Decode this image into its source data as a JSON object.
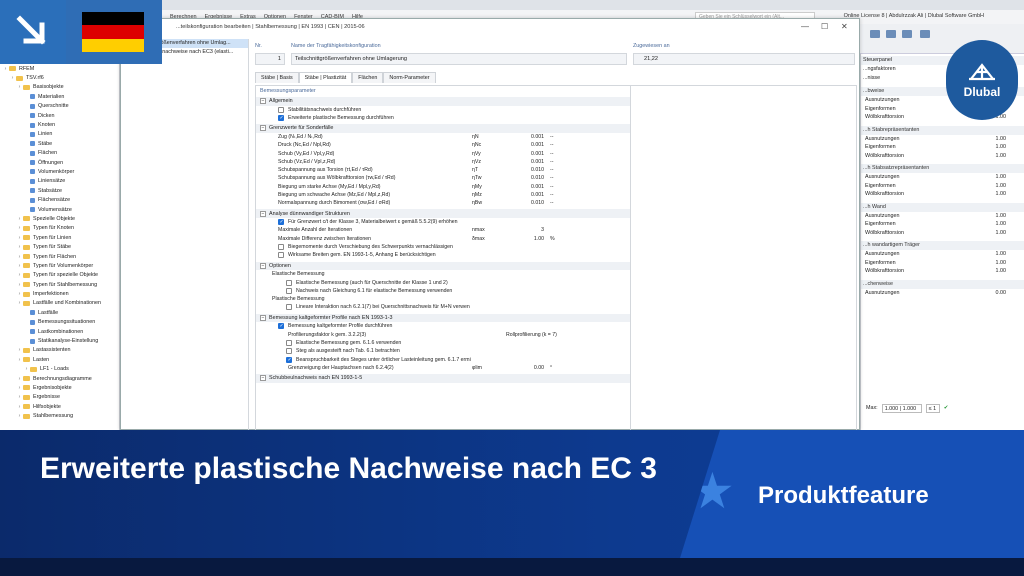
{
  "menubar": {
    "items": [
      "Berechnen",
      "Ergebnisse",
      "Extras",
      "Optionen",
      "Fenster",
      "CAD-BIM",
      "Hilfe"
    ],
    "search_placeholder": "Geben Sie ein Schlüsselwort ein (Alt...",
    "license": "Online License 8 | Abdulrzzak Ali | Dlubal Software GmbH"
  },
  "dialog": {
    "title": "...teilskonfiguration bearbeiten | Stahlbemessung | EN 1993 | CEN | 2015-06",
    "list": [
      {
        "no": "1",
        "name": "Teilschnittgrößenverfahren ohne Umlag...",
        "selected": true
      },
      {
        "no": "2",
        "name": "Querschnittsnachweise nach EC3 (elasti...",
        "selected": false
      }
    ],
    "no_label": "Nr.",
    "no_value": "1",
    "name_label": "Name der Tragfähigkeitskonfiguration",
    "name_value": "Teilschnittgrößenverfahren ohne Umlagerung",
    "assigned_label": "Zugewiesen an",
    "assigned_value": "21,22",
    "tabs": [
      "Stäbe | Basis",
      "Stäbe | Plastizität",
      "Flächen",
      "Norm-Parameter"
    ],
    "active_tab": 1,
    "params_title": "Bemessungsparameter"
  },
  "sections": {
    "allgemein": "Allgemein",
    "grenzwerte": "Grenzwerte für Sonderfälle",
    "analyse": "Analyse dünnwandiger Strukturen",
    "optionen": "Optionen",
    "elastische": "Elastische Bemessung",
    "plastische": "Plastische Bemessung",
    "kaltgeformt": "Bemessung kaltgeformter Profile nach EN 1993-1-3",
    "schubbeul": "Schubbeulnachweis nach EN 1993-1-5"
  },
  "rows": {
    "allg1": "Stabilitätsnachweis durchführen",
    "allg2": "Erweiterte plastische Bemessung durchführen",
    "g": [
      {
        "lab": "Zug (Nₜ,Ed / Nₜ,Rd)",
        "sym": "ηN",
        "val": "0.001",
        "unit": "--"
      },
      {
        "lab": "Druck (Nc,Ed / Npl,Rd)",
        "sym": "ηNc",
        "val": "0.001",
        "unit": "--"
      },
      {
        "lab": "Schub (Vy,Ed / Vpl,y,Rd)",
        "sym": "ηVy",
        "val": "0.001",
        "unit": "--"
      },
      {
        "lab": "Schub (Vz,Ed / Vpl,z,Rd)",
        "sym": "ηVz",
        "val": "0.001",
        "unit": "--"
      },
      {
        "lab": "Schubspannung aus Torsion (τt,Ed / τRd)",
        "sym": "ηT",
        "val": "0.010",
        "unit": "--"
      },
      {
        "lab": "Schubspannung aus Wölbkrafttorsion (τw,Ed / τRd)",
        "sym": "ηTw",
        "val": "0.010",
        "unit": "--"
      },
      {
        "lab": "Biegung um starke Achse (My,Ed / Mpl,y,Rd)",
        "sym": "ηMy",
        "val": "0.001",
        "unit": "--"
      },
      {
        "lab": "Biegung um schwache Achse (Mz,Ed / Mpl,z,Rd)",
        "sym": "ηMz",
        "val": "0.001",
        "unit": "--"
      },
      {
        "lab": "Normalspannung durch Bimoment (σw,Ed / σRd)",
        "sym": "ηBw",
        "val": "0.010",
        "unit": "--"
      }
    ],
    "a1": "Für Grenzwert c/t der Klasse 3, Materialbeiwert ε gemäß 5.5.2(9) erhöhen",
    "a2_lab": "Maximale Anzahl der Iterationen",
    "a2_sym": "nmax",
    "a2_val": "3",
    "a3_lab": "Maximale Differenz zwischen Iterationen",
    "a3_sym": "δmax",
    "a3_val": "1.00",
    "a3_unit": "%",
    "a4": "Biegemomente durch Verschiebung des Schwerpunkts vernachlässigen",
    "a5": "Wirksame Breiten gem. EN 1993-1-5, Anhang E berücksichtigen",
    "e1": "Elastische Bemessung (auch für Querschnitte der Klasse 1 und 2)",
    "e2": "Nachweis nach Gleichung 6.1 für elastische Bemessung verwenden",
    "p1": "Lineare Interaktion nach 6.2.1(7) bei Querschnittsnachweis für M+N verwen",
    "k1": "Bemessung kaltgeformter Profile durchführen",
    "k2_lab": "Profilierungsfaktor k gem. 3.2.2(3)",
    "k2_val": "Rollprofilierung (k = 7)",
    "k3": "Elastische Bemessung gem. 6.1.6 verwenden",
    "k4": "Steg als ausgesteift nach Tab. 6.1 betrachten",
    "k5": "Beanspruchbarkeit des Steges unter örtlicher Lasteinleitung gem. 6.1.7 ermi",
    "k6_lab": "Grenzneigung der Hauptachsen nach 6.2.4(2)",
    "k6_sym": "φlim",
    "k6_val": "0.00",
    "k6_unit": "°"
  },
  "nav": [
    {
      "t": "RFEM",
      "l": 0,
      "k": "root"
    },
    {
      "t": "TSV.rf6",
      "l": 1,
      "k": "file"
    },
    {
      "t": "Basisobjekte",
      "l": 2,
      "k": "f"
    },
    {
      "t": "Materialien",
      "l": 3,
      "k": "l"
    },
    {
      "t": "Querschnitte",
      "l": 3,
      "k": "l"
    },
    {
      "t": "Dicken",
      "l": 3,
      "k": "l"
    },
    {
      "t": "Knoten",
      "l": 3,
      "k": "l"
    },
    {
      "t": "Linien",
      "l": 3,
      "k": "l"
    },
    {
      "t": "Stäbe",
      "l": 3,
      "k": "l"
    },
    {
      "t": "Flächen",
      "l": 3,
      "k": "l"
    },
    {
      "t": "Öffnungen",
      "l": 3,
      "k": "l"
    },
    {
      "t": "Volumenkörper",
      "l": 3,
      "k": "l"
    },
    {
      "t": "Liniensätze",
      "l": 3,
      "k": "l"
    },
    {
      "t": "Stabsätze",
      "l": 3,
      "k": "l"
    },
    {
      "t": "Flächensätze",
      "l": 3,
      "k": "l"
    },
    {
      "t": "Volumensätze",
      "l": 3,
      "k": "l"
    },
    {
      "t": "Spezielle Objekte",
      "l": 2,
      "k": "f"
    },
    {
      "t": "Typen für Knoten",
      "l": 2,
      "k": "f"
    },
    {
      "t": "Typen für Linien",
      "l": 2,
      "k": "f"
    },
    {
      "t": "Typen für Stäbe",
      "l": 2,
      "k": "f"
    },
    {
      "t": "Typen für Flächen",
      "l": 2,
      "k": "f"
    },
    {
      "t": "Typen für Volumenkörper",
      "l": 2,
      "k": "f"
    },
    {
      "t": "Typen für spezielle Objekte",
      "l": 2,
      "k": "f"
    },
    {
      "t": "Typen für Stahlbemessung",
      "l": 2,
      "k": "f"
    },
    {
      "t": "Imperfektionen",
      "l": 2,
      "k": "f"
    },
    {
      "t": "Lastfälle und Kombinationen",
      "l": 2,
      "k": "f"
    },
    {
      "t": "Lastfälle",
      "l": 3,
      "k": "l"
    },
    {
      "t": "Bemessungssituationen",
      "l": 3,
      "k": "l"
    },
    {
      "t": "Lastkombinationen",
      "l": 3,
      "k": "l"
    },
    {
      "t": "Statikanalyse-Einstellung",
      "l": 3,
      "k": "l"
    },
    {
      "t": "Lastassistenten",
      "l": 2,
      "k": "f"
    },
    {
      "t": "Lasten",
      "l": 2,
      "k": "f"
    },
    {
      "t": "LF1 - Loads",
      "l": 3,
      "k": "f"
    },
    {
      "t": "Berechnungsdiagramme",
      "l": 2,
      "k": "f"
    },
    {
      "t": "Ergebnisobjekte",
      "l": 2,
      "k": "f"
    },
    {
      "t": "Ergebnisse",
      "l": 2,
      "k": "f"
    },
    {
      "t": "Hilfsobjekte",
      "l": 2,
      "k": "f"
    },
    {
      "t": "Stahlbemessung",
      "l": 2,
      "k": "f"
    }
  ],
  "rightpanel": {
    "title": "Steuerpanel",
    "lines": [
      "...ngsfaktoren",
      "...nisse"
    ],
    "groups": [
      {
        "h": "...bweise",
        "rows": [
          [
            "Ausnutzungen",
            "1.00"
          ],
          [
            "Eigenformen",
            "1.00"
          ],
          [
            "Wölbkrafttorsion",
            "1.00"
          ]
        ]
      },
      {
        "h": "...h Stabrepräsentanten",
        "rows": [
          [
            "Ausnutzungen",
            "1.00"
          ],
          [
            "Eigenformen",
            "1.00"
          ],
          [
            "Wölbkrafttorsion",
            "1.00"
          ]
        ]
      },
      {
        "h": "...h Stabsatzrepräsentanten",
        "rows": [
          [
            "Ausnutzungen",
            "1.00"
          ],
          [
            "Eigenformen",
            "1.00"
          ],
          [
            "Wölbkrafttorsion",
            "1.00"
          ]
        ]
      },
      {
        "h": "...h Wand",
        "rows": [
          [
            "Ausnutzungen",
            "1.00"
          ],
          [
            "Eigenformen",
            "1.00"
          ],
          [
            "Wölbkrafttorsion",
            "1.00"
          ]
        ]
      },
      {
        "h": "...h wandartigem Träger",
        "rows": [
          [
            "Ausnutzungen",
            "1.00"
          ],
          [
            "Eigenformen",
            "1.00"
          ],
          [
            "Wölbkrafttorsion",
            "1.00"
          ]
        ]
      },
      {
        "h": "...chenweise",
        "rows": [
          [
            "Ausnutzungen",
            "0.00"
          ]
        ]
      }
    ],
    "max_label": "Max:",
    "max_value": "1.000 | 1.000",
    "le_value": "≤ 1"
  },
  "overlay": {
    "logo_text": "Dlubal",
    "title": "Erweiterte plastische Nachweise nach EC 3",
    "badge": "Produktfeature",
    "flag_colors": [
      "#000000",
      "#dd0000",
      "#ffce00"
    ],
    "brand_color": "#0d3a8f"
  }
}
